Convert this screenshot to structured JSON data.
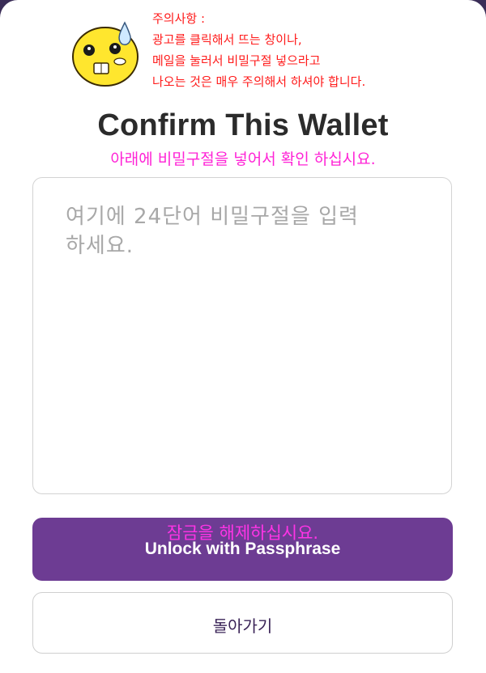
{
  "warning": {
    "lines": [
      "주의사항 :",
      "광고를 클릭해서 뜨는 창이나,",
      "메일을 눌러서 비밀구절 넣으라고",
      "나오는 것은 매우 주의해서 하셔야 합니다."
    ],
    "color": "#ff1a1a"
  },
  "mascot": {
    "icon": "sweating-face-icon",
    "color": "#ffe62e"
  },
  "title": "Confirm This Wallet",
  "subtitle": "아래에 비밀구절을 넣어서 확인 하십시요.",
  "passphrase_input": {
    "placeholder": "여기에 24단어 비밀구절을 입력\n하세요.",
    "value": ""
  },
  "unlock_button": {
    "overlay_text": "잠금을 해제하십시요.",
    "label": "Unlock with Passphrase",
    "color": "#6d3c93"
  },
  "back_button": {
    "label": "돌아가기"
  },
  "colors": {
    "accent": "#6d3c93",
    "annotation_pink": "#ff22d6",
    "annotation_red": "#ff1a1a"
  }
}
